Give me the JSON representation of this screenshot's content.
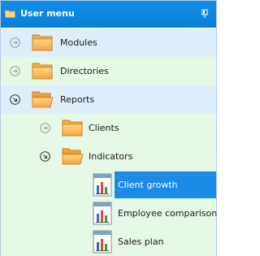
{
  "panel": {
    "title": "User menu",
    "title_icon": "folder-icon",
    "pin_icon": "pin-icon"
  },
  "tree": {
    "modules": {
      "label": "Modules",
      "state": "collapsed"
    },
    "directories": {
      "label": "Directories",
      "state": "collapsed"
    },
    "reports": {
      "label": "Reports",
      "state": "expanded"
    },
    "clients": {
      "label": "Clients",
      "state": "collapsed"
    },
    "indicators": {
      "label": "Indicators",
      "state": "expanded"
    },
    "client_growth": {
      "label": "Client growth",
      "selected": true
    },
    "employee_comparison": {
      "label": "Employee comparison"
    },
    "sales_plan": {
      "label": "Sales plan"
    }
  },
  "colors": {
    "title_bar": "#0a7dd6",
    "row_blue": "#dfeefb",
    "row_green": "#e6f8e6",
    "selection": "#1c8ae6"
  }
}
